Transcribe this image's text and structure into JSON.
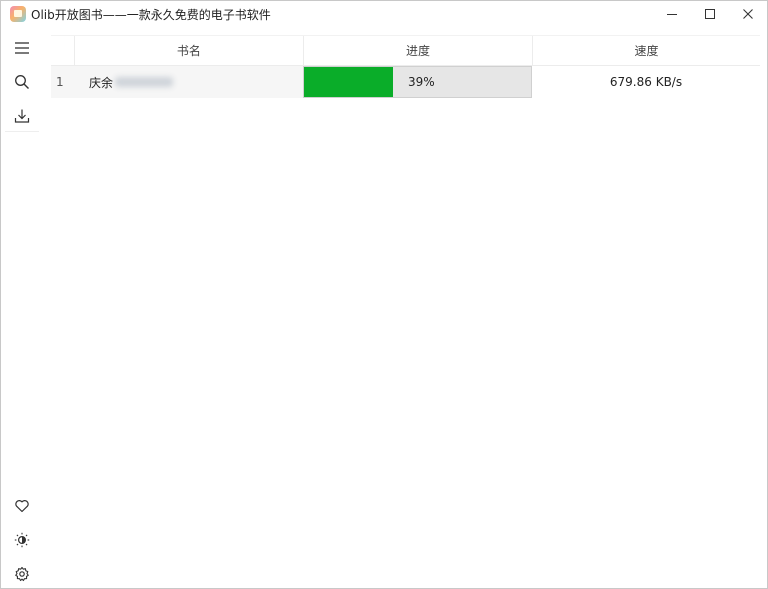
{
  "window": {
    "title": "Olib开放图书——一款永久免费的电子书软件",
    "controls": [
      "minimize-icon",
      "maximize-icon",
      "close-icon"
    ]
  },
  "sidebar": {
    "top_items": [
      "menu-icon",
      "search-icon",
      "download-icon"
    ],
    "bottom_items": [
      "heart-icon",
      "theme-toggle-icon",
      "settings-icon"
    ]
  },
  "table": {
    "columns": [
      "书名",
      "进度",
      "速度"
    ],
    "rows": [
      {
        "index": "1",
        "name": "庆余",
        "progress_label": "39%",
        "progress": 0.39,
        "speed": "679.86 KB/s"
      }
    ]
  },
  "colors": {
    "progress_fill": "#0aad29",
    "progress_track": "#e6e6e6"
  }
}
